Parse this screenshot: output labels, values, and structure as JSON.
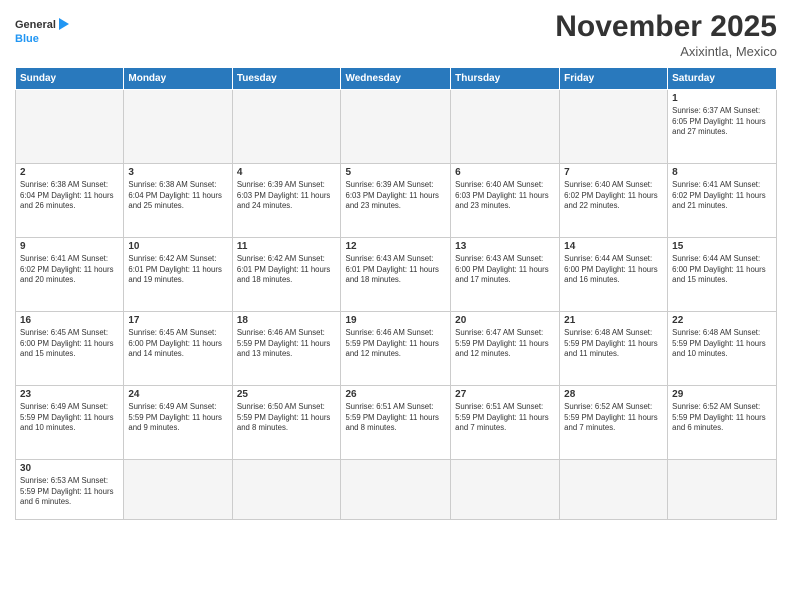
{
  "header": {
    "logo_general": "General",
    "logo_blue": "Blue",
    "month": "November 2025",
    "location": "Axixintla, Mexico"
  },
  "weekdays": [
    "Sunday",
    "Monday",
    "Tuesday",
    "Wednesday",
    "Thursday",
    "Friday",
    "Saturday"
  ],
  "weeks": [
    [
      {
        "day": "",
        "info": ""
      },
      {
        "day": "",
        "info": ""
      },
      {
        "day": "",
        "info": ""
      },
      {
        "day": "",
        "info": ""
      },
      {
        "day": "",
        "info": ""
      },
      {
        "day": "",
        "info": ""
      },
      {
        "day": "1",
        "info": "Sunrise: 6:37 AM\nSunset: 6:05 PM\nDaylight: 11 hours\nand 27 minutes."
      }
    ],
    [
      {
        "day": "2",
        "info": "Sunrise: 6:38 AM\nSunset: 6:04 PM\nDaylight: 11 hours\nand 26 minutes."
      },
      {
        "day": "3",
        "info": "Sunrise: 6:38 AM\nSunset: 6:04 PM\nDaylight: 11 hours\nand 25 minutes."
      },
      {
        "day": "4",
        "info": "Sunrise: 6:39 AM\nSunset: 6:03 PM\nDaylight: 11 hours\nand 24 minutes."
      },
      {
        "day": "5",
        "info": "Sunrise: 6:39 AM\nSunset: 6:03 PM\nDaylight: 11 hours\nand 23 minutes."
      },
      {
        "day": "6",
        "info": "Sunrise: 6:40 AM\nSunset: 6:03 PM\nDaylight: 11 hours\nand 23 minutes."
      },
      {
        "day": "7",
        "info": "Sunrise: 6:40 AM\nSunset: 6:02 PM\nDaylight: 11 hours\nand 22 minutes."
      },
      {
        "day": "8",
        "info": "Sunrise: 6:41 AM\nSunset: 6:02 PM\nDaylight: 11 hours\nand 21 minutes."
      }
    ],
    [
      {
        "day": "9",
        "info": "Sunrise: 6:41 AM\nSunset: 6:02 PM\nDaylight: 11 hours\nand 20 minutes."
      },
      {
        "day": "10",
        "info": "Sunrise: 6:42 AM\nSunset: 6:01 PM\nDaylight: 11 hours\nand 19 minutes."
      },
      {
        "day": "11",
        "info": "Sunrise: 6:42 AM\nSunset: 6:01 PM\nDaylight: 11 hours\nand 18 minutes."
      },
      {
        "day": "12",
        "info": "Sunrise: 6:43 AM\nSunset: 6:01 PM\nDaylight: 11 hours\nand 18 minutes."
      },
      {
        "day": "13",
        "info": "Sunrise: 6:43 AM\nSunset: 6:00 PM\nDaylight: 11 hours\nand 17 minutes."
      },
      {
        "day": "14",
        "info": "Sunrise: 6:44 AM\nSunset: 6:00 PM\nDaylight: 11 hours\nand 16 minutes."
      },
      {
        "day": "15",
        "info": "Sunrise: 6:44 AM\nSunset: 6:00 PM\nDaylight: 11 hours\nand 15 minutes."
      }
    ],
    [
      {
        "day": "16",
        "info": "Sunrise: 6:45 AM\nSunset: 6:00 PM\nDaylight: 11 hours\nand 15 minutes."
      },
      {
        "day": "17",
        "info": "Sunrise: 6:45 AM\nSunset: 6:00 PM\nDaylight: 11 hours\nand 14 minutes."
      },
      {
        "day": "18",
        "info": "Sunrise: 6:46 AM\nSunset: 5:59 PM\nDaylight: 11 hours\nand 13 minutes."
      },
      {
        "day": "19",
        "info": "Sunrise: 6:46 AM\nSunset: 5:59 PM\nDaylight: 11 hours\nand 12 minutes."
      },
      {
        "day": "20",
        "info": "Sunrise: 6:47 AM\nSunset: 5:59 PM\nDaylight: 11 hours\nand 12 minutes."
      },
      {
        "day": "21",
        "info": "Sunrise: 6:48 AM\nSunset: 5:59 PM\nDaylight: 11 hours\nand 11 minutes."
      },
      {
        "day": "22",
        "info": "Sunrise: 6:48 AM\nSunset: 5:59 PM\nDaylight: 11 hours\nand 10 minutes."
      }
    ],
    [
      {
        "day": "23",
        "info": "Sunrise: 6:49 AM\nSunset: 5:59 PM\nDaylight: 11 hours\nand 10 minutes."
      },
      {
        "day": "24",
        "info": "Sunrise: 6:49 AM\nSunset: 5:59 PM\nDaylight: 11 hours\nand 9 minutes."
      },
      {
        "day": "25",
        "info": "Sunrise: 6:50 AM\nSunset: 5:59 PM\nDaylight: 11 hours\nand 8 minutes."
      },
      {
        "day": "26",
        "info": "Sunrise: 6:51 AM\nSunset: 5:59 PM\nDaylight: 11 hours\nand 8 minutes."
      },
      {
        "day": "27",
        "info": "Sunrise: 6:51 AM\nSunset: 5:59 PM\nDaylight: 11 hours\nand 7 minutes."
      },
      {
        "day": "28",
        "info": "Sunrise: 6:52 AM\nSunset: 5:59 PM\nDaylight: 11 hours\nand 7 minutes."
      },
      {
        "day": "29",
        "info": "Sunrise: 6:52 AM\nSunset: 5:59 PM\nDaylight: 11 hours\nand 6 minutes."
      }
    ],
    [
      {
        "day": "30",
        "info": "Sunrise: 6:53 AM\nSunset: 5:59 PM\nDaylight: 11 hours\nand 6 minutes."
      },
      {
        "day": "",
        "info": ""
      },
      {
        "day": "",
        "info": ""
      },
      {
        "day": "",
        "info": ""
      },
      {
        "day": "",
        "info": ""
      },
      {
        "day": "",
        "info": ""
      },
      {
        "day": "",
        "info": ""
      }
    ]
  ]
}
